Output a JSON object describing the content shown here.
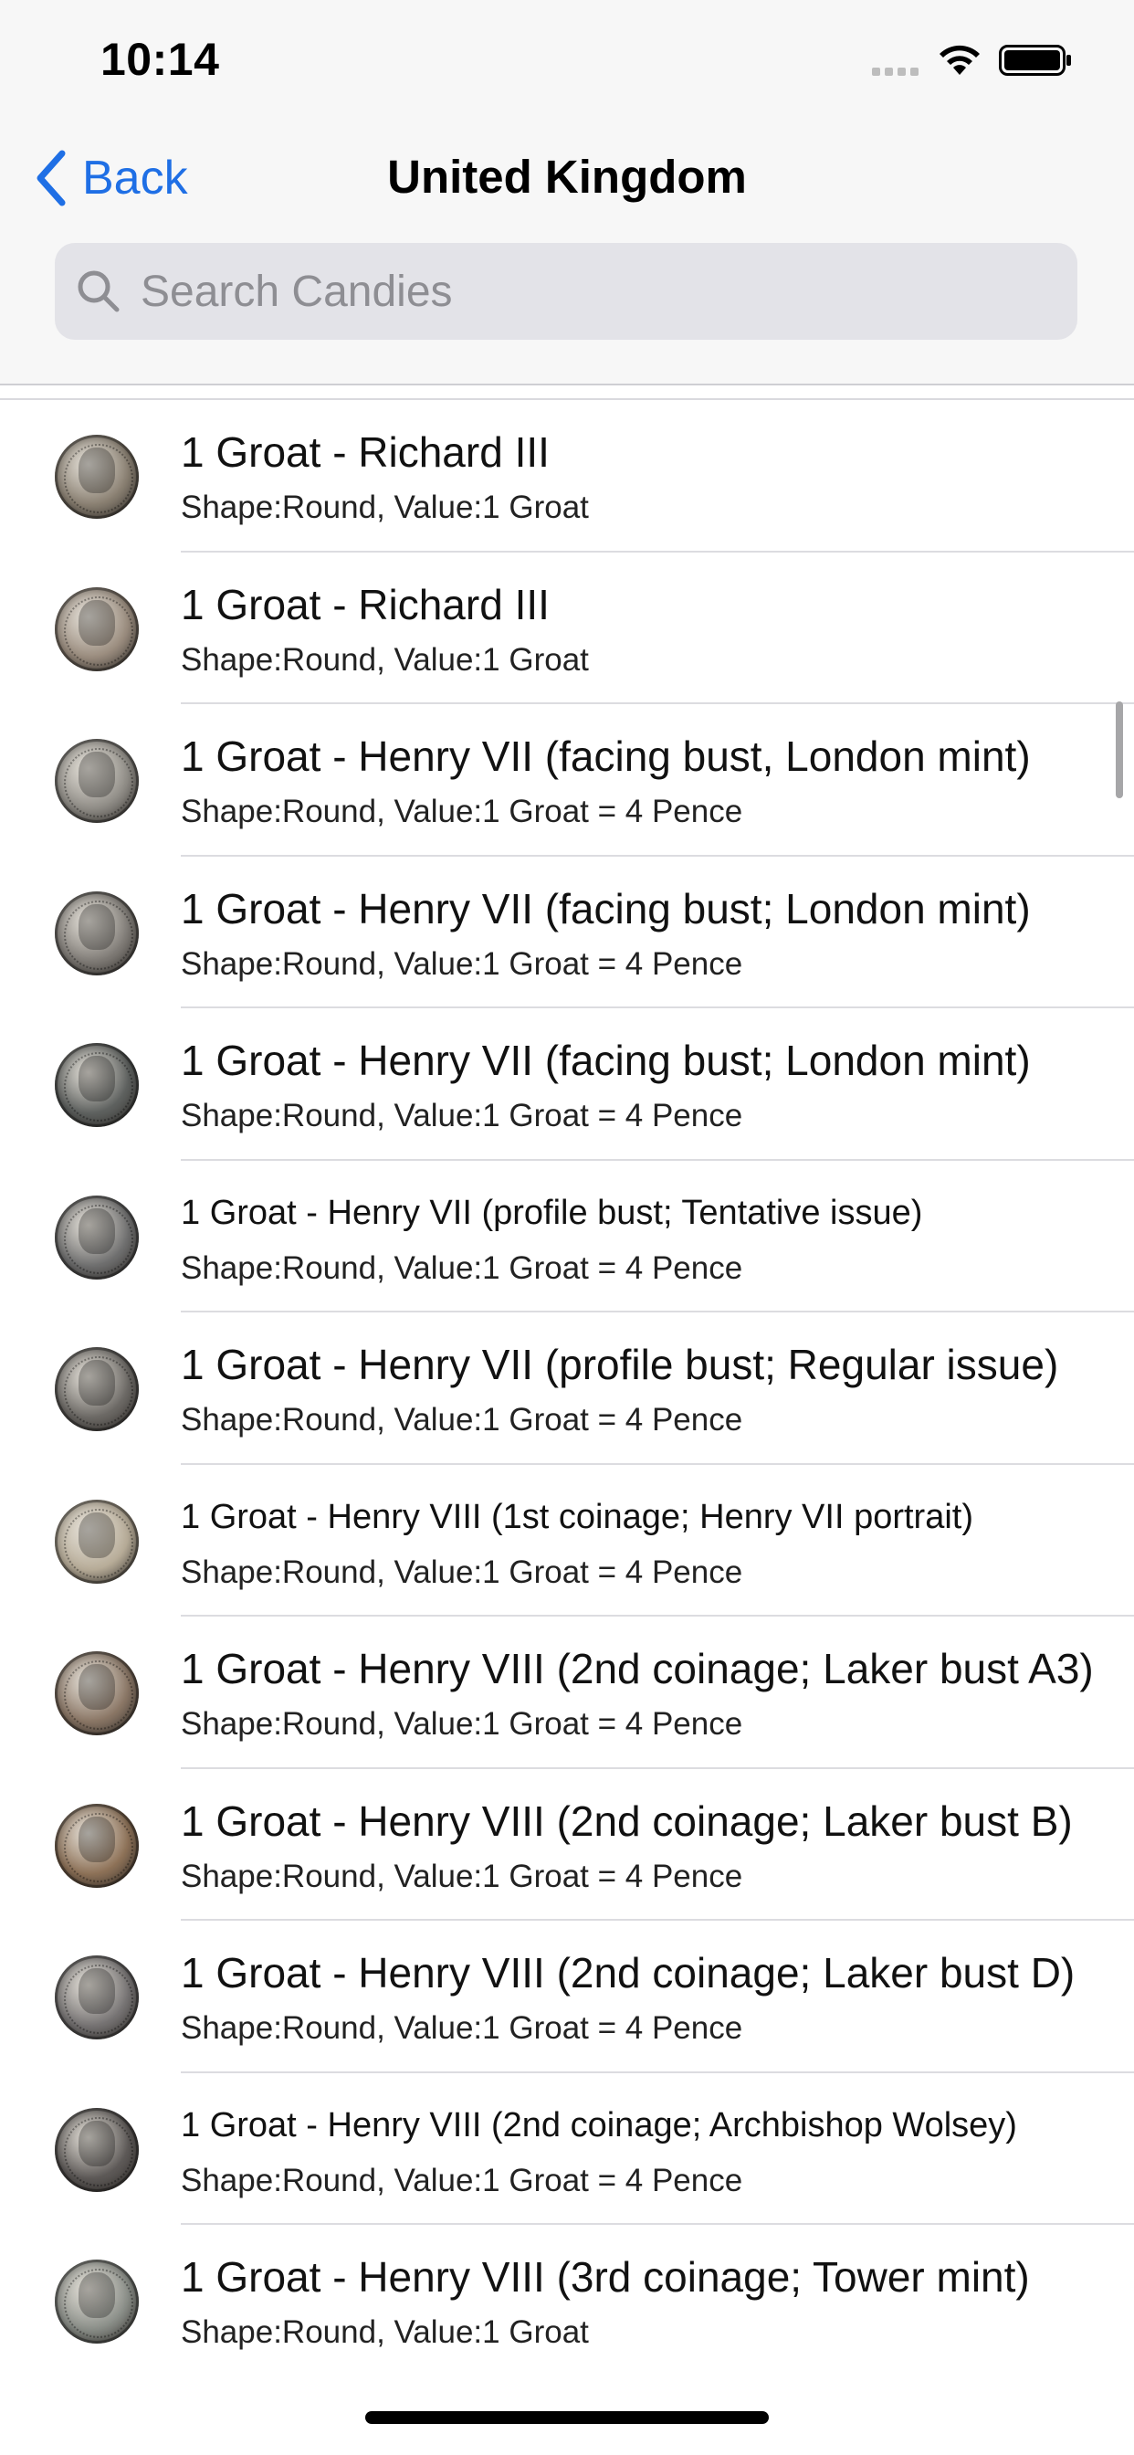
{
  "status_bar": {
    "time": "10:14"
  },
  "nav": {
    "back_label": "Back",
    "title": "United Kingdom"
  },
  "search": {
    "placeholder": "Search Candies",
    "value": ""
  },
  "items": [
    {
      "title": "1 Groat - Richard III",
      "subtitle": "Shape:Round, Value:1 Groat",
      "coin_color": "#8a8072"
    },
    {
      "title": "1 Groat - Richard III",
      "subtitle": "Shape:Round, Value:1 Groat",
      "coin_color": "#9a8c7e"
    },
    {
      "title": "1 Groat - Henry VII (facing bust, London mint)",
      "subtitle": "Shape:Round, Value:1 Groat = 4 Pence",
      "coin_color": "#8f8c86"
    },
    {
      "title": "1 Groat - Henry VII (facing bust; London mint)",
      "subtitle": "Shape:Round, Value:1 Groat = 4 Pence",
      "coin_color": "#7f7b76"
    },
    {
      "title": "1 Groat - Henry VII (facing bust; London mint)",
      "subtitle": "Shape:Round, Value:1 Groat = 4 Pence",
      "coin_color": "#5f6260"
    },
    {
      "title": "1 Groat - Henry VII (profile bust; Tentative issue)",
      "subtitle": "Shape:Round, Value:1 Groat = 4 Pence",
      "coin_color": "#707070"
    },
    {
      "title": "1 Groat - Henry VII (profile bust; Regular issue)",
      "subtitle": "Shape:Round, Value:1 Groat = 4 Pence",
      "coin_color": "#6d6a66"
    },
    {
      "title": "1 Groat - Henry VIII (1st coinage; Henry VII portrait)",
      "subtitle": "Shape:Round, Value:1 Groat = 4 Pence",
      "coin_color": "#b7ac98"
    },
    {
      "title": "1 Groat - Henry VIII (2nd coinage; Laker bust A3)",
      "subtitle": "Shape:Round, Value:1 Groat = 4 Pence",
      "coin_color": "#8b7766"
    },
    {
      "title": "1 Groat - Henry VIII (2nd coinage; Laker bust B)",
      "subtitle": "Shape:Round, Value:1 Groat = 4 Pence",
      "coin_color": "#8e7258"
    },
    {
      "title": "1 Groat - Henry VIII (2nd coinage; Laker bust D)",
      "subtitle": "Shape:Round, Value:1 Groat = 4 Pence",
      "coin_color": "#777474"
    },
    {
      "title": "1 Groat - Henry VIII (2nd coinage; Archbishop Wolsey)",
      "subtitle": "Shape:Round, Value:1 Groat = 4 Pence",
      "coin_color": "#5e5a58"
    },
    {
      "title": "1 Groat - Henry VIII (3rd coinage; Tower mint)",
      "subtitle": "Shape:Round, Value:1 Groat",
      "coin_color": "#8a8e88"
    }
  ]
}
